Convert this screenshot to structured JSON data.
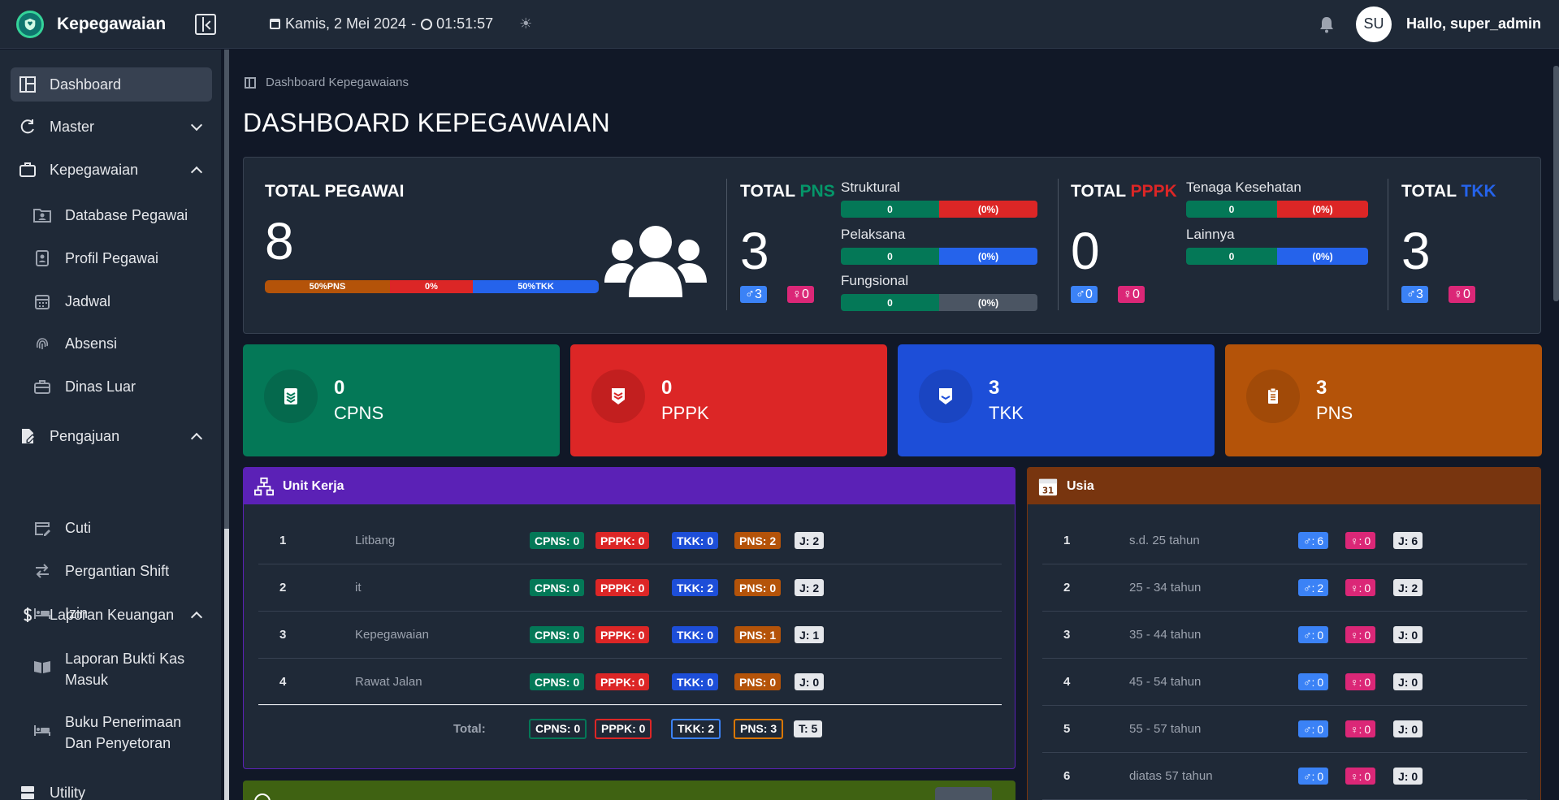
{
  "brand": {
    "name": "Kepegawaian"
  },
  "header": {
    "date": "Kamis, 2 Mei 2024",
    "separator": "-",
    "time": "01:51:57",
    "avatar_initials": "SU",
    "greeting": "Hallo, super_admin"
  },
  "sidebar": {
    "dashboard": "Dashboard",
    "master": "Master",
    "kepegawaian": "Kepegawaian",
    "database_pegawai": "Database Pegawai",
    "profil_pegawai": "Profil Pegawai",
    "jadwal": "Jadwal",
    "absensi": "Absensi",
    "dinas_luar": "Dinas Luar",
    "pengajuan": "Pengajuan",
    "cuti": "Cuti",
    "pergantian_shift": "Pergantian Shift",
    "izin": "Izin",
    "laporan_keuangan": "Laporan Keuangan",
    "laporan_bukti_kas_1": "Laporan Bukti Kas",
    "laporan_bukti_kas_2": "Masuk",
    "buku_penerimaan_1": "Buku Penerimaan",
    "buku_penerimaan_2": "Dan Penyetoran",
    "utility": "Utility"
  },
  "breadcrumb": "Dashboard Kepegawaians",
  "page_title": "DASHBOARD KEPEGAWAIAN",
  "summary": {
    "total_pegawai": {
      "title": "TOTAL PEGAWAI",
      "value": "8",
      "bar": [
        "50%PNS",
        "0%",
        "50%TKK"
      ]
    },
    "pns": {
      "title_prefix": "TOTAL",
      "title_suffix": "PNS",
      "value": "3",
      "male": "3",
      "female": "0",
      "bars": [
        {
          "label": "Struktural",
          "left": "0",
          "right": "(0%)"
        },
        {
          "label": "Pelaksana",
          "left": "0",
          "right": "(0%)"
        },
        {
          "label": "Fungsional",
          "left": "0",
          "right": "(0%)"
        }
      ]
    },
    "pppk": {
      "title_prefix": "TOTAL",
      "title_suffix": "PPPK",
      "value": "0",
      "male": "0",
      "female": "0",
      "bars": [
        {
          "label": "Tenaga Kesehatan",
          "left": "0",
          "right": "(0%)"
        },
        {
          "label": "Lainnya",
          "left": "0",
          "right": "(0%)"
        }
      ]
    },
    "tkk": {
      "title_prefix": "TOTAL",
      "title_suffix": "TKK",
      "value": "3",
      "male": "3",
      "female": "0"
    }
  },
  "stats": [
    {
      "value": "0",
      "label": "CPNS"
    },
    {
      "value": "0",
      "label": "PPPK"
    },
    {
      "value": "3",
      "label": "TKK"
    },
    {
      "value": "3",
      "label": "PNS"
    }
  ],
  "unit_kerja": {
    "title": "Unit Kerja",
    "rows": [
      {
        "no": "1",
        "name": "Litbang",
        "cpns": "CPNS: 0",
        "pppk": "PPPK: 0",
        "tkk": "TKK: 0",
        "pns": "PNS: 2",
        "j": "J: 2"
      },
      {
        "no": "2",
        "name": "it",
        "cpns": "CPNS: 0",
        "pppk": "PPPK: 0",
        "tkk": "TKK: 2",
        "pns": "PNS: 0",
        "j": "J: 2"
      },
      {
        "no": "3",
        "name": "Kepegawaian",
        "cpns": "CPNS: 0",
        "pppk": "PPPK: 0",
        "tkk": "TKK: 0",
        "pns": "PNS: 1",
        "j": "J: 1"
      },
      {
        "no": "4",
        "name": "Rawat Jalan",
        "cpns": "CPNS: 0",
        "pppk": "PPPK: 0",
        "tkk": "TKK: 0",
        "pns": "PNS: 0",
        "j": "J: 0"
      }
    ],
    "total": {
      "label": "Total:",
      "cpns": "CPNS: 0",
      "pppk": "PPPK: 0",
      "tkk": "TKK: 2",
      "pns": "PNS: 3",
      "t": "T: 5"
    }
  },
  "usia": {
    "title": "Usia",
    "icon_day": "31",
    "rows": [
      {
        "no": "1",
        "range": "s.d. 25 tahun",
        "m": "6",
        "f": "0",
        "j": "J: 6"
      },
      {
        "no": "2",
        "range": "25 - 34 tahun",
        "m": "2",
        "f": "0",
        "j": "J: 2"
      },
      {
        "no": "3",
        "range": "35 - 44 tahun",
        "m": "0",
        "f": "0",
        "j": "J: 0"
      },
      {
        "no": "4",
        "range": "45 - 54 tahun",
        "m": "0",
        "f": "0",
        "j": "J: 0"
      },
      {
        "no": "5",
        "range": "55 - 57 tahun",
        "m": "0",
        "f": "0",
        "j": "J: 0"
      },
      {
        "no": "6",
        "range": "diatas 57 tahun",
        "m": "0",
        "f": "0",
        "j": "J: 0"
      }
    ]
  },
  "symbols": {
    "male": "♂",
    "female": "♀",
    "colon": ":"
  },
  "colors": {
    "pns": "#059669",
    "pppk": "#dc2626",
    "tkk": "#2563eb",
    "accent_purple": "#5b21b6",
    "accent_brown": "#78350f"
  }
}
